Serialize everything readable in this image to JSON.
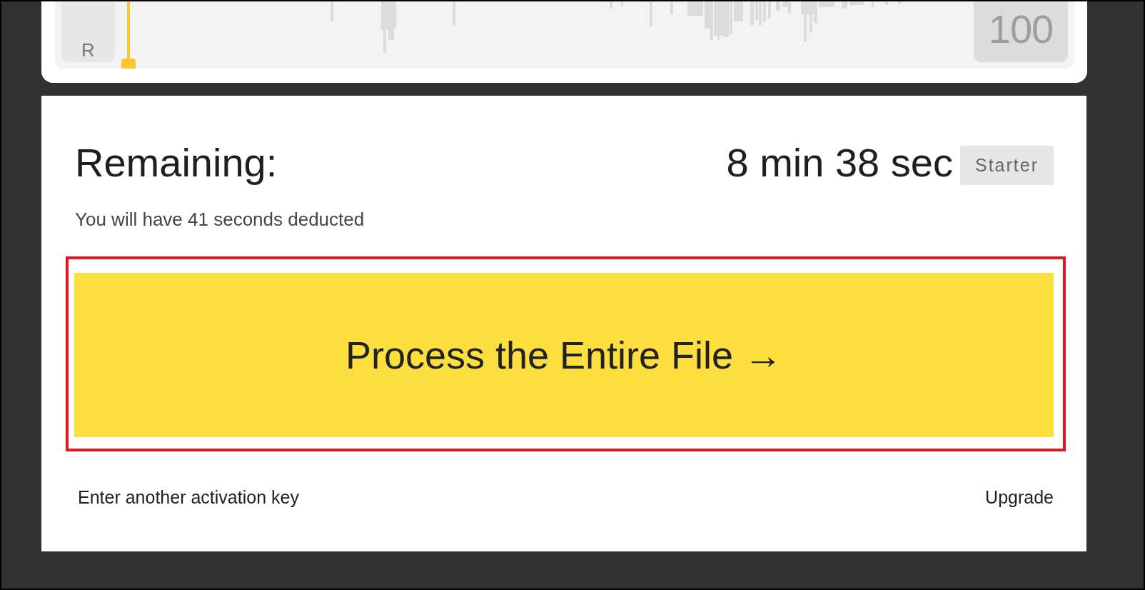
{
  "waveform_panel": {
    "start_label": "R",
    "end_label": "100",
    "playhead": {
      "level": 0
    }
  },
  "remaining": {
    "label": "Remaining:",
    "value": "8 min 38 sec",
    "plan_badge": "Starter",
    "note": "You will have 41 seconds deducted"
  },
  "process_button": {
    "label": "Process the Entire File →",
    "highlighted": true
  },
  "footer_links": [
    {
      "label": "Enter another activation key"
    },
    {
      "label": "Upgrade"
    }
  ]
}
